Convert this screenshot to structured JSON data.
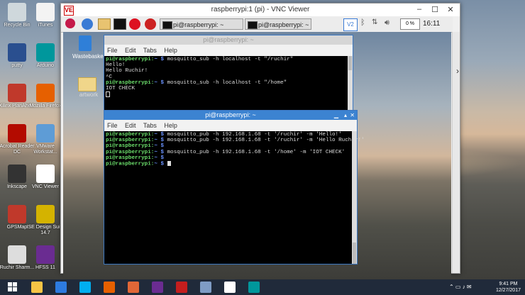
{
  "desktop_icons": [
    {
      "label": "Recycle Bin",
      "color": "#cfd8dc"
    },
    {
      "label": "iTunes",
      "color": "#f3f3f3"
    },
    {
      "label": "putty",
      "color": "#2a4f8f"
    },
    {
      "label": "Arduino",
      "color": "#00979c"
    },
    {
      "label": "Xilinx PlanAhe...",
      "color": "#c0392b"
    },
    {
      "label": "Mozilla Firefox",
      "color": "#e66000"
    },
    {
      "label": "Acrobat Reader DC",
      "color": "#b30b00"
    },
    {
      "label": "VMware Workstat...",
      "color": "#5e9cd6"
    },
    {
      "label": "Inkscape",
      "color": "#333333"
    },
    {
      "label": "VNC Viewer",
      "color": "#ffffff"
    },
    {
      "label": "GPSMap",
      "color": "#c0392b"
    },
    {
      "label": "ISE Design Suite 14.7",
      "color": "#d4b300"
    },
    {
      "label": "Ruchir Sharm...",
      "color": "#dddddd"
    },
    {
      "label": "HFSS 11",
      "color": "#6a2c91"
    }
  ],
  "vnc": {
    "title": "raspberrypi:1 (pi) - VNC Viewer",
    "logo": "VE"
  },
  "pi_taskbar": {
    "tasks": [
      "pi@raspberrypi: ~",
      "pi@raspberrypi: ~"
    ],
    "volume": "0 %",
    "time": "16:11"
  },
  "pi_desktop_icons": [
    {
      "label": "Wastebasket"
    },
    {
      "label": "artwork"
    }
  ],
  "terminal_sub": {
    "title": "pi@raspberrypi: ~",
    "menu": [
      "File",
      "Edit",
      "Tabs",
      "Help"
    ],
    "lines": [
      {
        "prompt": "pi@raspberrypi:",
        "path": "~ $",
        "cmd": " mosquitto_sub -h localhost -t \"/ruchir\""
      },
      {
        "text": "Hello!"
      },
      {
        "text": "Hello Ruchir!"
      },
      {
        "text": "^C"
      },
      {
        "prompt": "pi@raspberrypi:",
        "path": "~ $",
        "cmd": " mosquitto_sub -h localhost -t \"/home\""
      },
      {
        "text": "IOT CHECK"
      }
    ]
  },
  "terminal_pub": {
    "title": "pi@raspberrypi: ~",
    "menu": [
      "File",
      "Edit",
      "Tabs",
      "Help"
    ],
    "lines": [
      {
        "prompt": "pi@raspberrypi:",
        "path": "~ $",
        "cmd": " mosquitto_pub -h 192.168.1.68 -t '/ruchir' -m 'Hello!'"
      },
      {
        "prompt": "pi@raspberrypi:",
        "path": "~ $",
        "cmd": " mosquitto_pub -h 192.168.1.68 -t '/ruchir' -m 'Hello Ruchir!'"
      },
      {
        "prompt": "pi@raspberrypi:",
        "path": "~ $",
        "cmd": ""
      },
      {
        "prompt": "pi@raspberrypi:",
        "path": "~ $",
        "cmd": " mosquitto_pub -h 192.168.1.68 -t '/home' -m 'IOT CHECK'"
      },
      {
        "prompt": "pi@raspberrypi:",
        "path": "~ $",
        "cmd": ""
      },
      {
        "prompt": "pi@raspberrypi:",
        "path": "~ $",
        "cmd": " "
      }
    ]
  },
  "win_taskbar": {
    "apps": [
      "start",
      "explorer",
      "defender",
      "skype",
      "firefox",
      "matlab",
      "hfss",
      "flash",
      "network",
      "vnc",
      "arduino"
    ],
    "time": "9:41 PM",
    "date": "12/27/2017"
  }
}
